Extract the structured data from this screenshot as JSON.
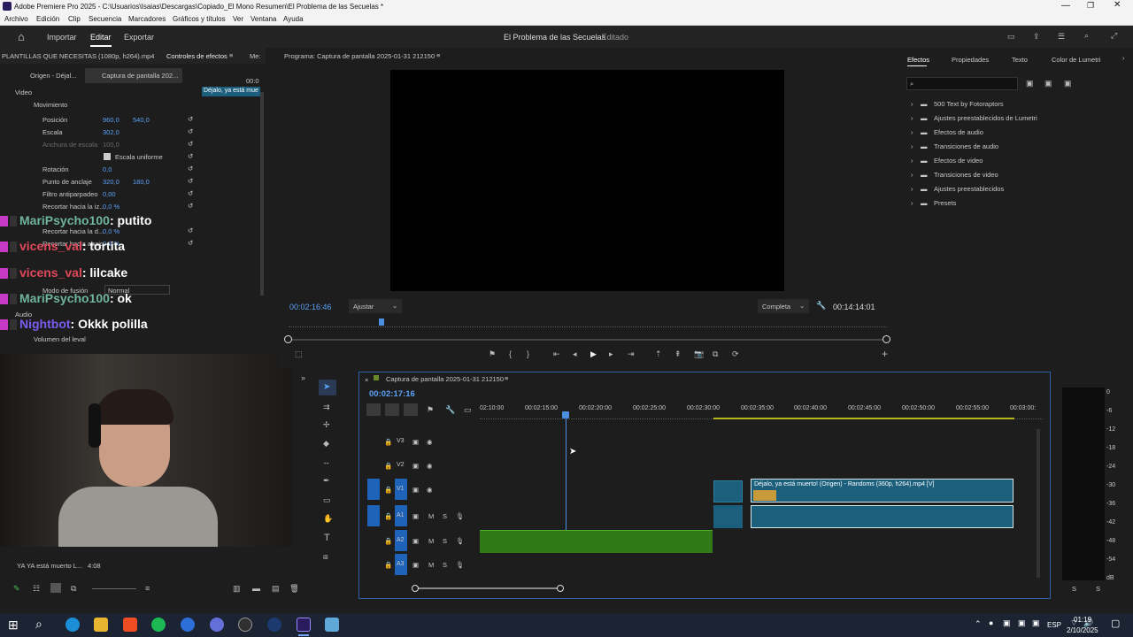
{
  "window": {
    "title": "Adobe Premiere Pro 2025 - C:\\Usuarios\\Isaias\\Descargas\\Copiado_El Mono Resumen\\El Problema de las Secuelas *"
  },
  "menu": [
    "Archivo",
    "Edición",
    "Clip",
    "Secuencia",
    "Marcadores",
    "Gráficos y títulos",
    "Ver",
    "Ventana",
    "Ayuda"
  ],
  "appbar": {
    "nav": [
      "Importar",
      "Editar",
      "Exportar"
    ],
    "project_title": "El Problema de las Secuelas",
    "project_status": "- Editado"
  },
  "left_panel": {
    "header_left": "PLANTILLAS QUE NECESITAS (1080p, h264).mp4",
    "header_tab": "Controles de efectos",
    "header_more": "Me:",
    "source_tab": "Origen - Déjal...",
    "clip_tab": "Captura de pantalla 202...",
    "mini_time": "00:0",
    "mini_clip_label": "Déjalo, ya está mue",
    "section_video": "Video",
    "fx_motion": "Movimiento",
    "rows": [
      {
        "name": "Posición",
        "v1": "960,0",
        "v2": "540,0"
      },
      {
        "name": "Escala",
        "v1": "302,0",
        "v2": ""
      },
      {
        "name": "Anchura de escala",
        "v1": "100,0",
        "v2": ""
      },
      {
        "name": "Escala uniforme",
        "v1": "",
        "v2": ""
      },
      {
        "name": "Rotación",
        "v1": "0,0",
        "v2": ""
      },
      {
        "name": "Punto de anclaje",
        "v1": "320,0",
        "v2": "180,0"
      },
      {
        "name": "Filtro antiparpadeo",
        "v1": "0,00",
        "v2": ""
      },
      {
        "name": "Recortar hacia la iz...",
        "v1": "0,0 %",
        "v2": ""
      },
      {
        "name": "Recortar hacia la d...",
        "v1": "0,0 %",
        "v2": ""
      },
      {
        "name": "Recortar hacia abajo",
        "v1": "0,0 %",
        "v2": ""
      }
    ],
    "opacity": "Opacidad",
    "blend_label": "Modo de fusión",
    "blend_value": "Normal",
    "section_audio": "Audio",
    "fx_volume": "Volumen del leval"
  },
  "chat": [
    {
      "user": "MariPsycho100",
      "msg": ": putito",
      "color": "#6fb4a0"
    },
    {
      "user": "vicens_val",
      "msg": ": tortita",
      "color": "#e0485a"
    },
    {
      "user": "vicens_val",
      "msg": ": lilcake",
      "color": "#e0485a"
    },
    {
      "user": "MariPsycho100",
      "msg": ": ok",
      "color": "#6fb4a0"
    },
    {
      "user": "Nightbot",
      "msg": ": Okkk polilla",
      "color": "#7a5cf0"
    }
  ],
  "bottom_left": {
    "clip_name": "YA YA está muerto  L...",
    "clip_duration": "4:08"
  },
  "program": {
    "title": "Programa: Captura de pantalla 2025-01-31 212150",
    "timecode": "00:02:16:46",
    "fit": "Ajustar",
    "quality": "Completa",
    "duration": "00:14:14:01"
  },
  "effects": {
    "tabs": [
      "Efectos",
      "Propiedades",
      "Texto",
      "Color de Lumetri"
    ],
    "items": [
      "500 Text by Fotoraptors",
      "Ajustes preestablecidos de Lumetri",
      "Efectos de audio",
      "Transiciones de audio",
      "Efectos de video",
      "Transiciones de video",
      "Ajustes preestablecidos",
      "Presets"
    ]
  },
  "timeline": {
    "sequence": "Captura de pantalla 2025-01-31 212150",
    "timecode": "00:02:17:16",
    "ruler": [
      "02:10:00",
      "00:02:15:00",
      "00:02:20:00",
      "00:02:25:00",
      "00:02:30:00",
      "00:02:35:00",
      "00:02:40:00",
      "00:02:45:00",
      "00:02:50:00",
      "00:02:55:00",
      "00:03:00:"
    ],
    "tracks_video": [
      "V3",
      "V2",
      "V1"
    ],
    "tracks_audio": [
      "A1",
      "A2",
      "A3"
    ],
    "clip_label": "Déjalo, ya está muerto! (Origen) - Randoms (360p, h264).mp4 [V]"
  },
  "meter": {
    "scale": [
      "0",
      "-6",
      "-12",
      "-18",
      "-24",
      "-30",
      "-36",
      "-42",
      "-48",
      "-54",
      "dB"
    ],
    "channels": [
      "S",
      "S"
    ]
  },
  "taskbar": {
    "lang": "ESP",
    "time": "01:19",
    "date": "2/10/2025"
  }
}
